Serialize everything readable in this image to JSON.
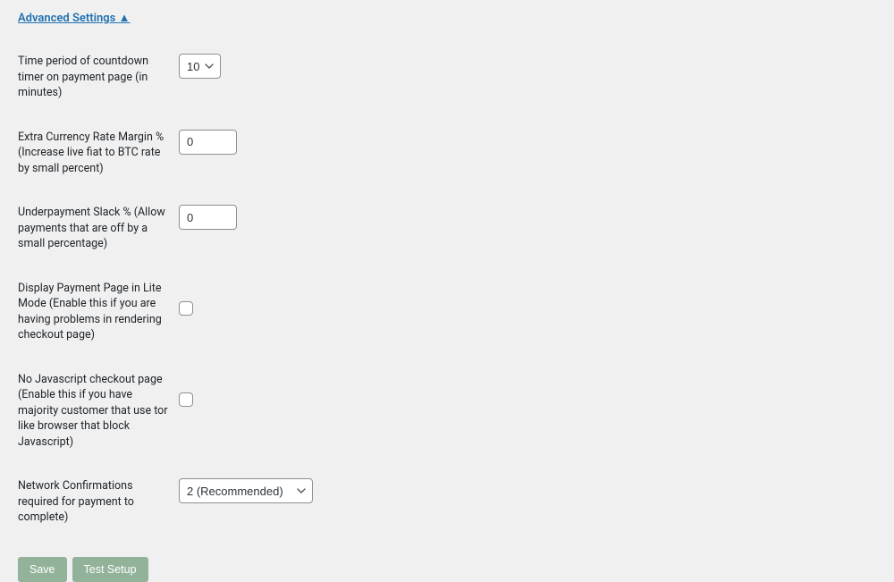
{
  "header": {
    "advanced_toggle": "Advanced Settings ▲"
  },
  "fields": {
    "countdown": {
      "label": "Time period of countdown timer on payment page (in minutes)",
      "value": "10"
    },
    "margin": {
      "label": "Extra Currency Rate Margin % (Increase live fiat to BTC rate by small percent)",
      "value": "0"
    },
    "slack": {
      "label": "Underpayment Slack % (Allow payments that are off by a small percentage)",
      "value": "0"
    },
    "lite_mode": {
      "label": "Display Payment Page in Lite Mode (Enable this if you are having problems in rendering checkout page)"
    },
    "no_js": {
      "label": "No Javascript checkout page (Enable this if you have majority customer that use tor like browser that block Javascript)"
    },
    "confirmations": {
      "label": "Network Confirmations required for payment to complete)",
      "value": "2 (Recommended)"
    }
  },
  "buttons": {
    "save": "Save",
    "test": "Test Setup"
  }
}
